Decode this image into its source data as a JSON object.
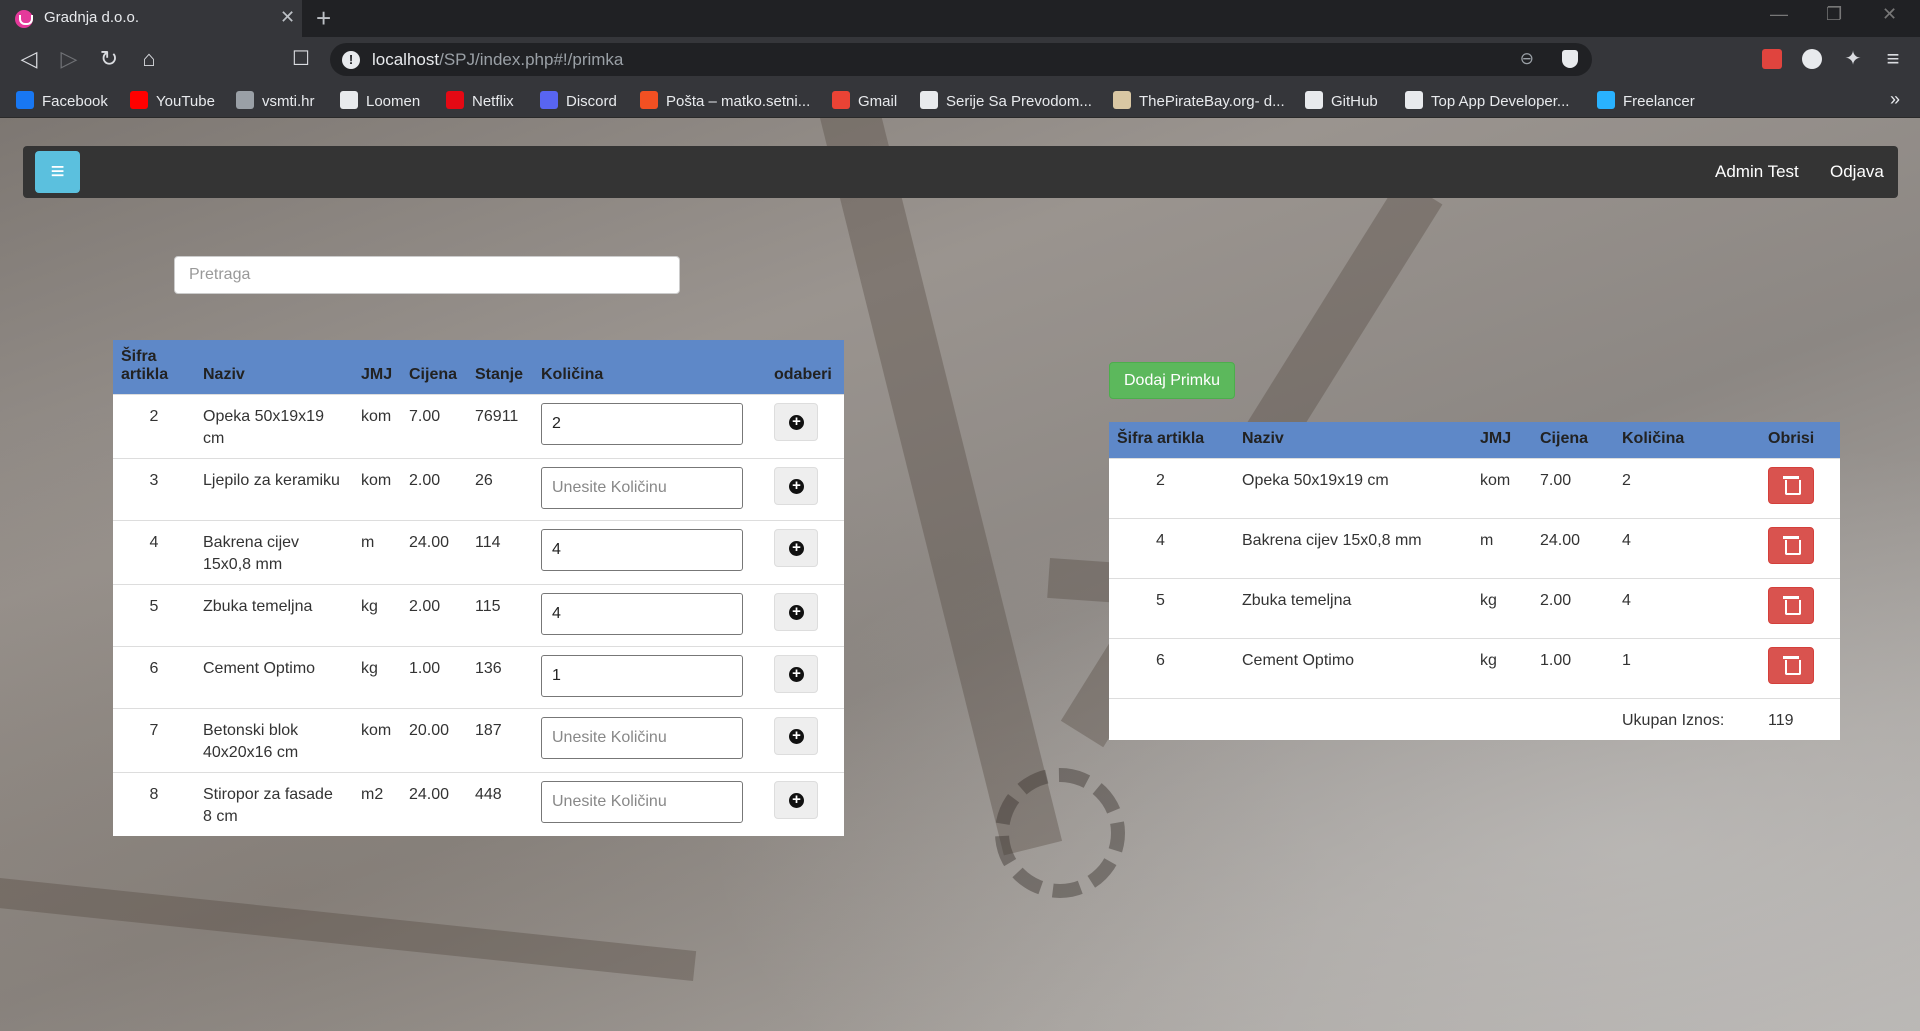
{
  "browser": {
    "tab_title": "Gradnja d.o.o.",
    "url_host": "localhost",
    "url_path": "/SPJ/index.php#!/primka",
    "bookmarks": [
      {
        "label": "Facebook",
        "color": "#1877f2"
      },
      {
        "label": "YouTube",
        "color": "#ff0000"
      },
      {
        "label": "vsmti.hr",
        "color": "#9aa0a6"
      },
      {
        "label": "Loomen",
        "color": "#e8eaed"
      },
      {
        "label": "Netflix",
        "color": "#e50914"
      },
      {
        "label": "Discord",
        "color": "#5865f2"
      },
      {
        "label": "Pošta – matko.setni...",
        "color": "#f25022"
      },
      {
        "label": "Gmail",
        "color": "#ea4335"
      },
      {
        "label": "Serije Sa Prevodom...",
        "color": "#e8eaed"
      },
      {
        "label": "ThePirateBay.org- d...",
        "color": "#d9c7a3"
      },
      {
        "label": "GitHub",
        "color": "#e8eaed"
      },
      {
        "label": "Top App Developer...",
        "color": "#e8eaed"
      },
      {
        "label": "Freelancer",
        "color": "#29b2fe"
      }
    ]
  },
  "nav": {
    "menu_icon": "≡",
    "user": "Admin Test",
    "logout": "Odjava"
  },
  "search": {
    "placeholder": "Pretraga"
  },
  "left_table": {
    "headers": [
      "Šifra artikla",
      "Naziv",
      "JMJ",
      "Cijena",
      "Stanje",
      "Količina",
      "odaberi"
    ],
    "qty_placeholder": "Unesite Količinu",
    "rows": [
      {
        "id": "2",
        "name": "Opeka 50x19x19 cm",
        "unit": "kom",
        "price": "7.00",
        "stock": "76911",
        "qty": "2"
      },
      {
        "id": "3",
        "name": "Ljepilo za keramiku",
        "unit": "kom",
        "price": "2.00",
        "stock": "26",
        "qty": ""
      },
      {
        "id": "4",
        "name": "Bakrena cijev 15x0,8 mm",
        "unit": "m",
        "price": "24.00",
        "stock": "114",
        "qty": "4"
      },
      {
        "id": "5",
        "name": "Zbuka temeljna",
        "unit": "kg",
        "price": "2.00",
        "stock": "115",
        "qty": "4"
      },
      {
        "id": "6",
        "name": "Cement Optimo",
        "unit": "kg",
        "price": "1.00",
        "stock": "136",
        "qty": "1"
      },
      {
        "id": "7",
        "name": "Betonski blok 40x20x16 cm",
        "unit": "kom",
        "price": "20.00",
        "stock": "187",
        "qty": ""
      },
      {
        "id": "8",
        "name": "Stiropor za fasade 8 cm",
        "unit": "m2",
        "price": "24.00",
        "stock": "448",
        "qty": ""
      }
    ]
  },
  "add_button": "Dodaj Primku",
  "right_table": {
    "headers": [
      "Šifra artikla",
      "Naziv",
      "JMJ",
      "Cijena",
      "Količina",
      "Obrisi"
    ],
    "rows": [
      {
        "id": "2",
        "name": "Opeka 50x19x19 cm",
        "unit": "kom",
        "price": "7.00",
        "qty": "2"
      },
      {
        "id": "4",
        "name": "Bakrena cijev 15x0,8 mm",
        "unit": "m",
        "price": "24.00",
        "qty": "4"
      },
      {
        "id": "5",
        "name": "Zbuka temeljna",
        "unit": "kg",
        "price": "2.00",
        "qty": "4"
      },
      {
        "id": "6",
        "name": "Cement Optimo",
        "unit": "kg",
        "price": "1.00",
        "qty": "1"
      }
    ],
    "total_label": "Ukupan Iznos:",
    "total_value": "119"
  }
}
